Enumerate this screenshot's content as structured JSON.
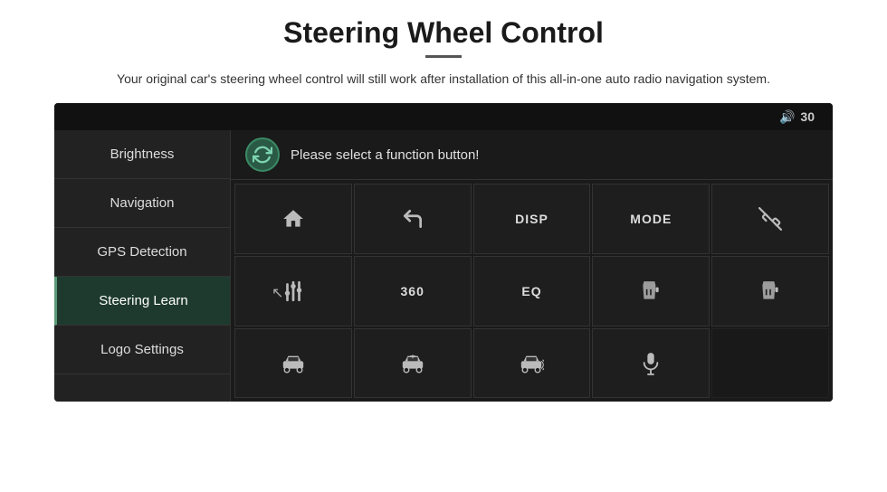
{
  "page": {
    "title": "Steering Wheel Control",
    "subtitle": "Your original car's steering wheel control will still work after installation of this all-in-one auto radio navigation system.",
    "divider": true
  },
  "header": {
    "volume_icon": "🔊",
    "volume_value": "30"
  },
  "sidebar": {
    "items": [
      {
        "id": "brightness",
        "label": "Brightness",
        "active": false,
        "selected": false
      },
      {
        "id": "navigation",
        "label": "Navigation",
        "active": false,
        "selected": false
      },
      {
        "id": "gps-detection",
        "label": "GPS Detection",
        "active": false,
        "selected": false
      },
      {
        "id": "steering-learn",
        "label": "Steering Learn",
        "active": false,
        "selected": true
      },
      {
        "id": "logo-settings",
        "label": "Logo Settings",
        "active": false,
        "selected": false
      }
    ]
  },
  "content": {
    "sync_icon": "↻",
    "prompt_text": "Please select a function button!",
    "grid": [
      [
        {
          "id": "home",
          "type": "icon",
          "label": "home"
        },
        {
          "id": "back",
          "type": "icon",
          "label": "back"
        },
        {
          "id": "disp",
          "type": "text",
          "label": "DISP"
        },
        {
          "id": "mode",
          "type": "text",
          "label": "MODE"
        },
        {
          "id": "phone-off",
          "type": "icon",
          "label": "phone-off"
        }
      ],
      [
        {
          "id": "eq-sliders",
          "type": "icon",
          "label": "sliders"
        },
        {
          "id": "360",
          "type": "text",
          "label": "360"
        },
        {
          "id": "eq",
          "type": "text",
          "label": "EQ"
        },
        {
          "id": "beer1",
          "type": "icon",
          "label": "icon1"
        },
        {
          "id": "beer2",
          "type": "icon",
          "label": "icon2"
        }
      ],
      [
        {
          "id": "car1",
          "type": "icon",
          "label": "car1"
        },
        {
          "id": "car2",
          "type": "icon",
          "label": "car2"
        },
        {
          "id": "car3",
          "type": "icon",
          "label": "car3"
        },
        {
          "id": "mic",
          "type": "icon",
          "label": "mic"
        },
        {
          "id": "empty",
          "type": "empty",
          "label": ""
        }
      ]
    ]
  }
}
